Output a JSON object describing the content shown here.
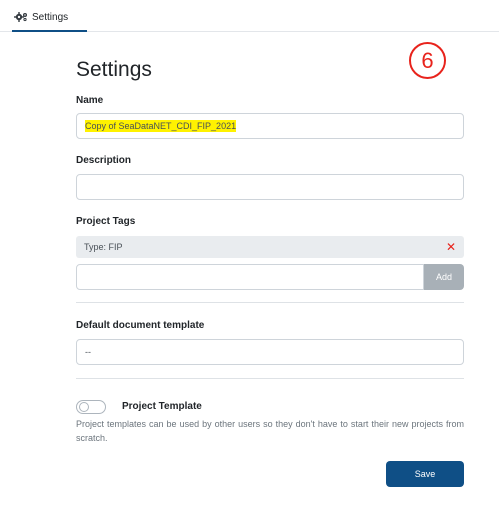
{
  "tabs": {
    "settings_label": "Settings"
  },
  "annotation": {
    "step_number": "6"
  },
  "page": {
    "title": "Settings"
  },
  "form": {
    "name_label": "Name",
    "name_value": "Copy of SeaDataNET_CDI_FIP_2021",
    "description_label": "Description",
    "description_value": "",
    "tags_label": "Project Tags",
    "tags": [
      {
        "text": "Type: FIP"
      }
    ],
    "tag_input_value": "",
    "add_label": "Add",
    "template_label": "Default document template",
    "template_selected": "--",
    "project_template_label": "Project Template",
    "project_template_enabled": false,
    "project_template_help": "Project templates can be used by other users so they don't have to start their new projects from scratch.",
    "save_label": "Save"
  },
  "colors": {
    "primary": "#0f4f86",
    "danger": "#e8231c",
    "highlight": "#fff200",
    "disabled_button": "#a8b0b7"
  },
  "icons": {
    "tab_icon": "gears-icon",
    "remove_tag_icon": "close-icon"
  }
}
